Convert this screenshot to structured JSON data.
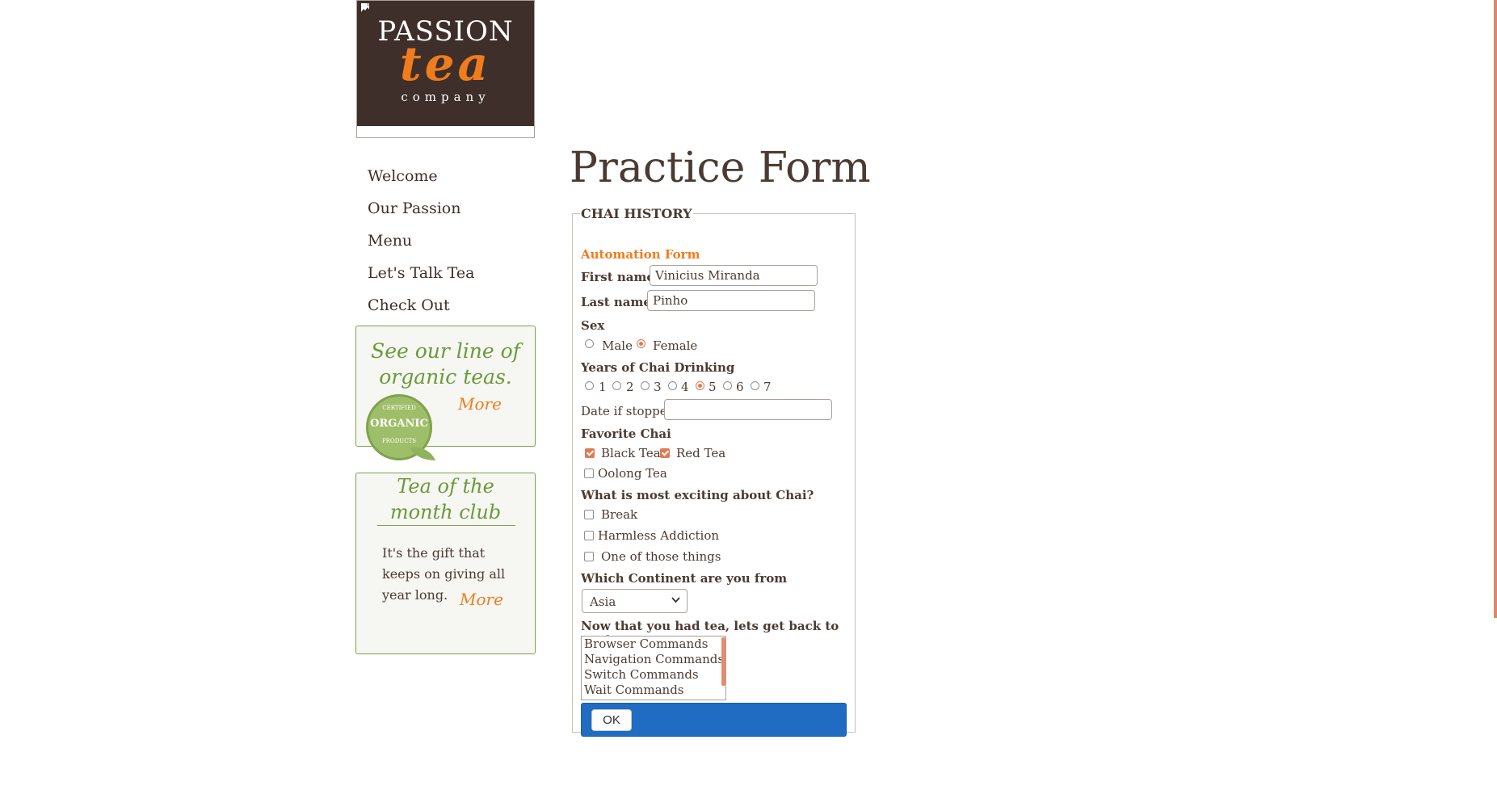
{
  "logo": {
    "line1": "PASSION",
    "line2": "tea",
    "line3": "company"
  },
  "nav": {
    "items": [
      "Welcome",
      "Our Passion",
      "Menu",
      "Let's Talk Tea",
      "Check Out"
    ]
  },
  "promo1": {
    "line1": "See our line of",
    "line2": "organic teas.",
    "more": "More",
    "badge_top": "CERTIFIED",
    "badge_main": "ORGANIC",
    "badge_bottom": "PRODUCTS"
  },
  "promo2": {
    "line1": "Tea of the",
    "line2": "month club",
    "text": "It's the gift that keeps on giving all year long.",
    "more": "More"
  },
  "page": {
    "title": "Practice Form"
  },
  "form": {
    "legend": "CHAI HISTORY",
    "subtitle": "Automation Form",
    "first_name_label": "First name:",
    "first_name_value": "Vinicius Miranda",
    "last_name_label": "Last name:",
    "last_name_value": "Pinho",
    "sex_label": "Sex",
    "sex_options": [
      "Male",
      "Female"
    ],
    "sex_selected": "Female",
    "years_label": "Years of Chai Drinking",
    "years_options": [
      "1",
      "2",
      "3",
      "4",
      "5",
      "6",
      "7"
    ],
    "years_selected": "5",
    "date_label": "Date if stopped",
    "date_value": "",
    "favorite_label": "Favorite Chai",
    "favorite_options": [
      "Black Tea",
      "Red Tea",
      "Oolong Tea"
    ],
    "favorite_checked": [
      "Black Tea",
      "Red Tea"
    ],
    "exciting_label": "What is most exciting about Chai?",
    "exciting_options": [
      "Break",
      "Harmless Addiction",
      "One of those things"
    ],
    "continent_label": "Which Continent are you from",
    "continent_selected": "Asia",
    "commands_label": "Now that you had tea, lets get back to work:)",
    "commands_options": [
      "Browser Commands",
      "Navigation Commands",
      "Switch Commands",
      "Wait Commands"
    ],
    "ok_label": "OK"
  },
  "colors": {
    "brand_dark": "#3f2f2a",
    "accent_orange": "#ef7d1e",
    "green": "#7fa24e",
    "ok_bar": "#1f6cc2"
  }
}
